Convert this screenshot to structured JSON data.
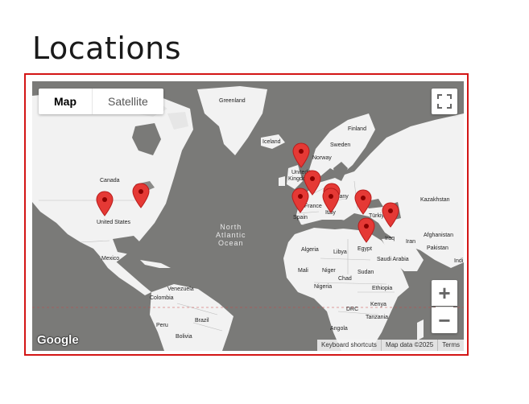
{
  "page": {
    "title": "Locations"
  },
  "map": {
    "type_control": {
      "map_label": "Map",
      "satellite_label": "Satellite",
      "selected": "Map"
    },
    "zoom": {
      "in_label": "+",
      "out_label": "−"
    },
    "logo_text": "Google",
    "attribution": {
      "shortcuts": "Keyboard shortcuts",
      "data": "Map data ©2025",
      "terms": "Terms"
    },
    "ocean_label": [
      "North",
      "Atlantic",
      "Ocean"
    ],
    "place_labels": [
      "Greenland",
      "Iceland",
      "Finland",
      "Sweden",
      "Norway",
      "United",
      "Kingdom",
      "Germany",
      "France",
      "Spain",
      "Italy",
      "Türkiye",
      "Kazakhstan",
      "Canada",
      "United States",
      "Mexico",
      "Venezuela",
      "Colombia",
      "Brazil",
      "Peru",
      "Bolivia",
      "Algeria",
      "Libya",
      "Egypt",
      "Iraq",
      "Iran",
      "Afghanistan",
      "Pakistan",
      "Saudi Arabia",
      "Mali",
      "Niger",
      "Chad",
      "Sudan",
      "Nigeria",
      "Ethiopia",
      "DRC",
      "Kenya",
      "Tanzania",
      "Angola",
      "Indi"
    ],
    "colors": {
      "water": "#7a7a78",
      "land": "#f2f2f2",
      "marker": "#e53935",
      "frame": "#d31515"
    },
    "marker_count": 10
  }
}
